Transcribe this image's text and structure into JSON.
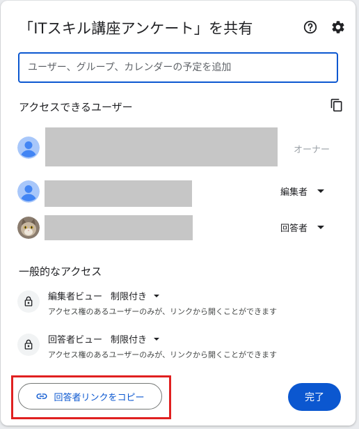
{
  "dialog": {
    "title": "「ITスキル講座アンケート」を共有",
    "help_icon": "help-circle-icon",
    "settings_icon": "gear-icon"
  },
  "share_input": {
    "placeholder": "ユーザー、グループ、カレンダーの予定を追加",
    "value": ""
  },
  "access_users": {
    "heading": "アクセスできるユーザー",
    "copy_icon": "copy-icon",
    "users": [
      {
        "avatar": "default-avatar-icon",
        "role": "オーナー",
        "has_dropdown": false
      },
      {
        "avatar": "default-avatar-icon",
        "role": "編集者",
        "has_dropdown": true
      },
      {
        "avatar": "cat-photo-avatar",
        "role": "回答者",
        "has_dropdown": true
      }
    ]
  },
  "general_access": {
    "heading": "一般的なアクセス",
    "items": [
      {
        "icon": "lock-icon",
        "view": "編集者ビュー",
        "level": "制限付き",
        "description": "アクセス権のあるユーザーのみが、リンクから開くことができます"
      },
      {
        "icon": "lock-icon",
        "view": "回答者ビュー",
        "level": "制限付き",
        "description": "アクセス権のあるユーザーのみが、リンクから開くことができます"
      }
    ]
  },
  "footer": {
    "copy_link_label": "回答者リンクをコピー",
    "copy_link_icon": "link-icon",
    "done_label": "完了",
    "highlight_color": "#e02020"
  },
  "colors": {
    "accent": "#0b57d0",
    "redaction": "#c6c6c6",
    "avatar_bg": "#a8c7fa",
    "avatar_fg": "#4285f4"
  }
}
